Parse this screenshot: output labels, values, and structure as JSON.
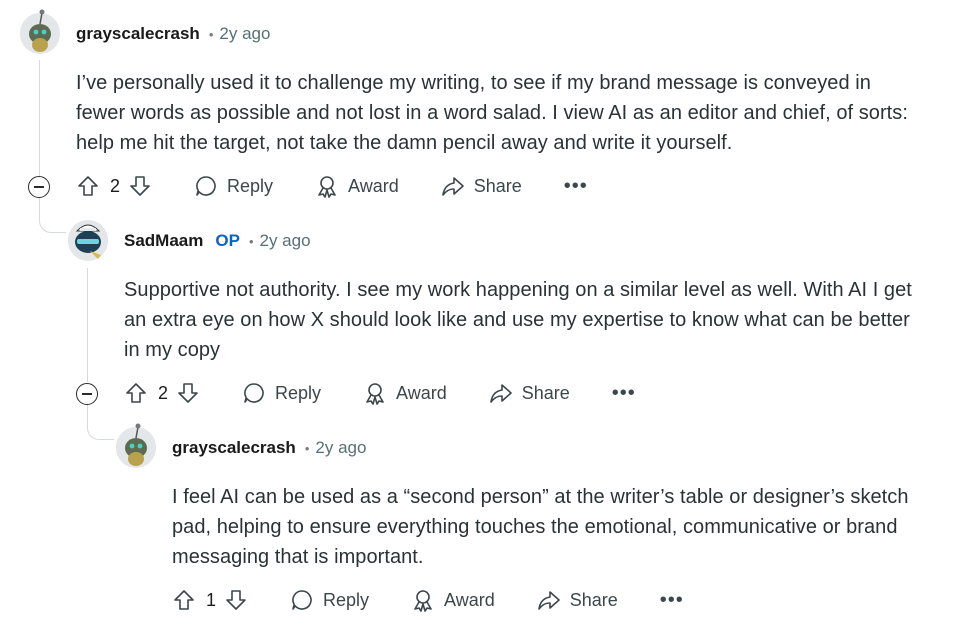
{
  "comments": [
    {
      "username": "grayscalecrash",
      "op_badge": "",
      "time": "2y ago",
      "text": "I’ve personally used it to challenge my writing, to see if my brand message is conveyed in fewer words as possible and not lost in a word salad. I view AI as an editor and chief, of sorts: help me hit the target, not take the damn pencil away and write it yourself.",
      "votes": "2",
      "reply_label": "Reply",
      "award_label": "Award",
      "share_label": "Share",
      "more_label": "•••"
    },
    {
      "username": "SadMaam",
      "op_badge": "OP",
      "time": "2y ago",
      "text": "Supportive not authority. I see my work happening on a similar level as well. With AI I get an extra eye on how X should look like and use my expertise to know what can be better in my copy",
      "votes": "2",
      "reply_label": "Reply",
      "award_label": "Award",
      "share_label": "Share",
      "more_label": "•••"
    },
    {
      "username": "grayscalecrash",
      "op_badge": "",
      "time": "2y ago",
      "text": "I feel AI can be used as a “second person” at the writer’s table or designer’s sketch pad, helping to ensure everything touches the emotional, communicative or brand messaging that is important.",
      "votes": "1",
      "reply_label": "Reply",
      "award_label": "Award",
      "share_label": "Share",
      "more_label": "•••"
    }
  ],
  "separator": "•",
  "icons": [
    "upvote-icon",
    "downvote-icon",
    "reply-bubble-icon",
    "award-icon",
    "share-arrow-icon",
    "collapse-icon",
    "more-options-icon"
  ]
}
